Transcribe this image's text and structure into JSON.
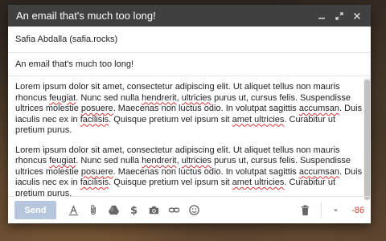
{
  "window": {
    "title": "An email that's much too long!"
  },
  "fields": {
    "recipient": "Safia Abdalla (safia.rocks)",
    "subject": "An email that's much too long!"
  },
  "body": {
    "paragraph1": [
      {
        "t": "Lorem ipsum dolor sit amet, consectetur adipiscing elit. Ut aliquet tellus non mauris rhoncus "
      },
      {
        "t": "feugiat",
        "err": true
      },
      {
        "t": ". Nunc sed nulla "
      },
      {
        "t": "hendrerit",
        "err": true
      },
      {
        "t": ", "
      },
      {
        "t": "ultricies",
        "err": true
      },
      {
        "t": " purus ut, cursus felis. Suspendisse ultrices molestie "
      },
      {
        "t": "posuere",
        "err": true
      },
      {
        "t": ". Maecenas non luctus odio. In volutpat sagittis "
      },
      {
        "t": "accumsan",
        "err": true
      },
      {
        "t": ". Duis iaculis nec ex in "
      },
      {
        "t": "facilisis",
        "err": true
      },
      {
        "t": ". Quisque pretium vel ipsum sit "
      },
      {
        "t": "amet ultricies",
        "err": true
      },
      {
        "t": ". Curabitur ut pretium purus."
      }
    ],
    "paragraph2": [
      {
        "t": "Lorem ipsum dolor sit amet, consectetur adipiscing elit. Ut aliquet tellus non mauris rhoncus "
      },
      {
        "t": "feugiat",
        "err": true
      },
      {
        "t": ". Nunc sed nulla "
      },
      {
        "t": "hendrerit",
        "err": true
      },
      {
        "t": ", "
      },
      {
        "t": "ultricies",
        "err": true
      },
      {
        "t": " purus ut, cursus felis. Suspendisse ultrices molestie "
      },
      {
        "t": "posuere",
        "err": true
      },
      {
        "t": ". Maecenas non luctus odio. In volutpat sagittis "
      },
      {
        "t": "accumsan",
        "err": true
      },
      {
        "t": ". Duis iaculis nec ex in "
      },
      {
        "t": "facilisis",
        "err": true
      },
      {
        "t": ". Quisque pretium vel ipsum sit "
      },
      {
        "t": "amet ultricies",
        "err": true
      },
      {
        "t": ". Curabitur ut pretium purus."
      }
    ]
  },
  "toolbar": {
    "send_label": "Send",
    "icons": [
      "format-text-icon",
      "attach-icon",
      "drive-icon",
      "money-icon",
      "camera-icon",
      "link-icon",
      "emoji-icon",
      "trash-icon",
      "more-options-icon"
    ],
    "counter": "-86"
  },
  "colors": {
    "titlebar": "#404040",
    "send": "#b5c6dd",
    "counter": "#d23f31"
  }
}
